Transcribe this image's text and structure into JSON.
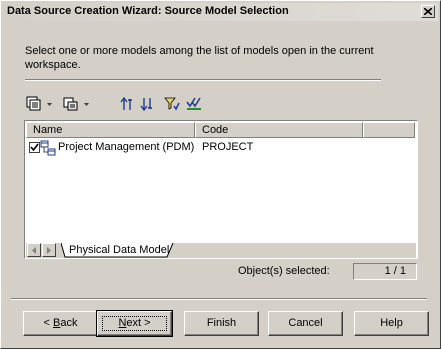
{
  "window": {
    "title": "Data Source Creation Wizard:  Source Model Selection"
  },
  "description": "Select one or more models among the list of models open in the current workspace.",
  "toolbar": {
    "icons": [
      "properties-icon",
      "dropdown-icon",
      "find-icon",
      "dropdown-icon",
      "move-up-icon",
      "move-down-icon",
      "filter-icon",
      "select-all-icon"
    ]
  },
  "list": {
    "columns": [
      {
        "label": "Name"
      },
      {
        "label": "Code"
      }
    ],
    "rows": [
      {
        "checked": true,
        "name": "Project Management (PDM)",
        "code": "PROJECT"
      }
    ]
  },
  "tabs": [
    {
      "label": "Physical Data Model",
      "selected": true
    }
  ],
  "selection": {
    "label": "Object(s) selected:",
    "value": "1 / 1"
  },
  "buttons": {
    "back": {
      "mnemonic": "B",
      "rest": "ack",
      "prefix": "< "
    },
    "next": {
      "mnemonic": "N",
      "rest": "ext >"
    },
    "finish": "Finish",
    "cancel": "Cancel",
    "help": "Help"
  }
}
